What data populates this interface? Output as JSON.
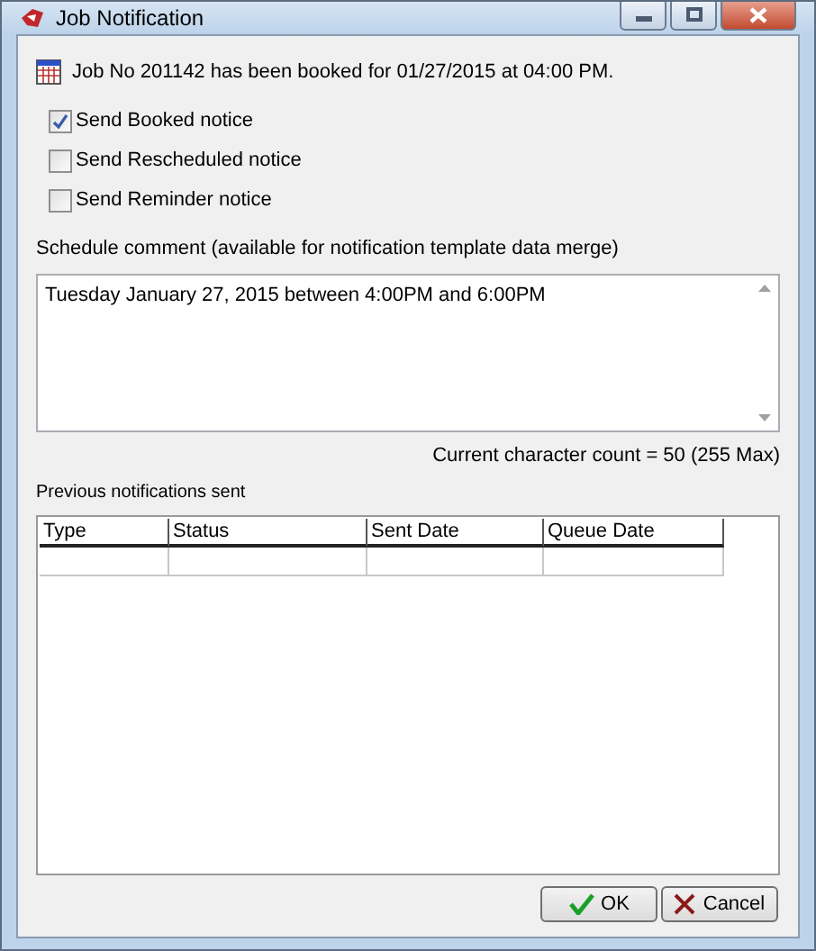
{
  "window": {
    "title": "Job Notification"
  },
  "booking_message": "Job No 201142 has been booked for 01/27/2015 at 04:00 PM.",
  "options": [
    {
      "label": "Send Booked notice",
      "checked": true
    },
    {
      "label": "Send Rescheduled notice",
      "checked": false
    },
    {
      "label": "Send Reminder notice",
      "checked": false
    }
  ],
  "comment": {
    "label": "Schedule comment (available for notification template data merge)",
    "value": "Tuesday January 27, 2015 between 4:00PM and 6:00PM",
    "count": "Current character count = 50 (255 Max)"
  },
  "history": {
    "label": "Previous notifications sent",
    "columns": [
      "Type",
      "Status",
      "Sent Date",
      "Queue Date"
    ]
  },
  "buttons": [
    {
      "label": "OK",
      "kind": "ok"
    },
    {
      "label": "Cancel",
      "kind": "cancel"
    }
  ]
}
